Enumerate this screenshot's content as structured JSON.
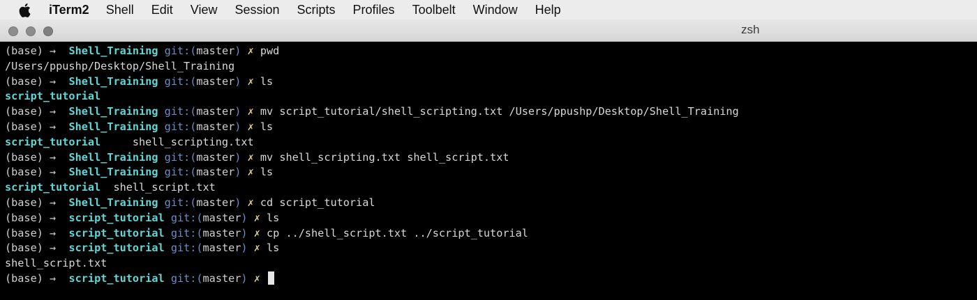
{
  "menubar": {
    "apple_icon": "apple-logo",
    "items": [
      "iTerm2",
      "Shell",
      "Edit",
      "View",
      "Session",
      "Scripts",
      "Profiles",
      "Toolbelt",
      "Window",
      "Help"
    ]
  },
  "window": {
    "title": "zsh"
  },
  "colors": {
    "background": "#000000",
    "directory": "#5fd7d7",
    "git": "#6b8ec7",
    "text": "#d0d0d0"
  },
  "terminal": {
    "lines": [
      {
        "type": "prompt",
        "env": "(base)",
        "arrow": "→",
        "dir": "Shell_Training",
        "git": "git:(",
        "branch": "master",
        "git_close": ")",
        "mark": "✗",
        "command": "pwd"
      },
      {
        "type": "output",
        "parts": [
          {
            "text": "/Users/ppushp/Desktop/Shell_Training",
            "kind": "out"
          }
        ]
      },
      {
        "type": "prompt",
        "env": "(base)",
        "arrow": "→",
        "dir": "Shell_Training",
        "git": "git:(",
        "branch": "master",
        "git_close": ")",
        "mark": "✗",
        "command": "ls"
      },
      {
        "type": "output",
        "parts": [
          {
            "text": "script_tutorial",
            "kind": "outdir"
          }
        ]
      },
      {
        "type": "prompt",
        "env": "(base)",
        "arrow": "→",
        "dir": "Shell_Training",
        "git": "git:(",
        "branch": "master",
        "git_close": ")",
        "mark": "✗",
        "command": "mv script_tutorial/shell_scripting.txt /Users/ppushp/Desktop/Shell_Training"
      },
      {
        "type": "prompt",
        "env": "(base)",
        "arrow": "→",
        "dir": "Shell_Training",
        "git": "git:(",
        "branch": "master",
        "git_close": ")",
        "mark": "✗",
        "command": "ls"
      },
      {
        "type": "output",
        "parts": [
          {
            "text": "script_tutorial",
            "kind": "outdir"
          },
          {
            "text": "     shell_scripting.txt",
            "kind": "out"
          }
        ]
      },
      {
        "type": "prompt",
        "env": "(base)",
        "arrow": "→",
        "dir": "Shell_Training",
        "git": "git:(",
        "branch": "master",
        "git_close": ")",
        "mark": "✗",
        "command": "mv shell_scripting.txt shell_script.txt"
      },
      {
        "type": "prompt",
        "env": "(base)",
        "arrow": "→",
        "dir": "Shell_Training",
        "git": "git:(",
        "branch": "master",
        "git_close": ")",
        "mark": "✗",
        "command": "ls"
      },
      {
        "type": "output",
        "parts": [
          {
            "text": "script_tutorial",
            "kind": "outdir"
          },
          {
            "text": "  shell_script.txt",
            "kind": "out"
          }
        ]
      },
      {
        "type": "prompt",
        "env": "(base)",
        "arrow": "→",
        "dir": "Shell_Training",
        "git": "git:(",
        "branch": "master",
        "git_close": ")",
        "mark": "✗",
        "command": "cd script_tutorial"
      },
      {
        "type": "prompt",
        "env": "(base)",
        "arrow": "→",
        "dir": "script_tutorial",
        "git": "git:(",
        "branch": "master",
        "git_close": ")",
        "mark": "✗",
        "command": "ls"
      },
      {
        "type": "prompt",
        "env": "(base)",
        "arrow": "→",
        "dir": "script_tutorial",
        "git": "git:(",
        "branch": "master",
        "git_close": ")",
        "mark": "✗",
        "command": "cp ../shell_script.txt ../script_tutorial"
      },
      {
        "type": "prompt",
        "env": "(base)",
        "arrow": "→",
        "dir": "script_tutorial",
        "git": "git:(",
        "branch": "master",
        "git_close": ")",
        "mark": "✗",
        "command": "ls"
      },
      {
        "type": "output",
        "parts": [
          {
            "text": "shell_script.txt",
            "kind": "out"
          }
        ]
      },
      {
        "type": "prompt",
        "env": "(base)",
        "arrow": "→",
        "dir": "script_tutorial",
        "git": "git:(",
        "branch": "master",
        "git_close": ")",
        "mark": "✗",
        "command": "",
        "cursor": true
      }
    ]
  }
}
